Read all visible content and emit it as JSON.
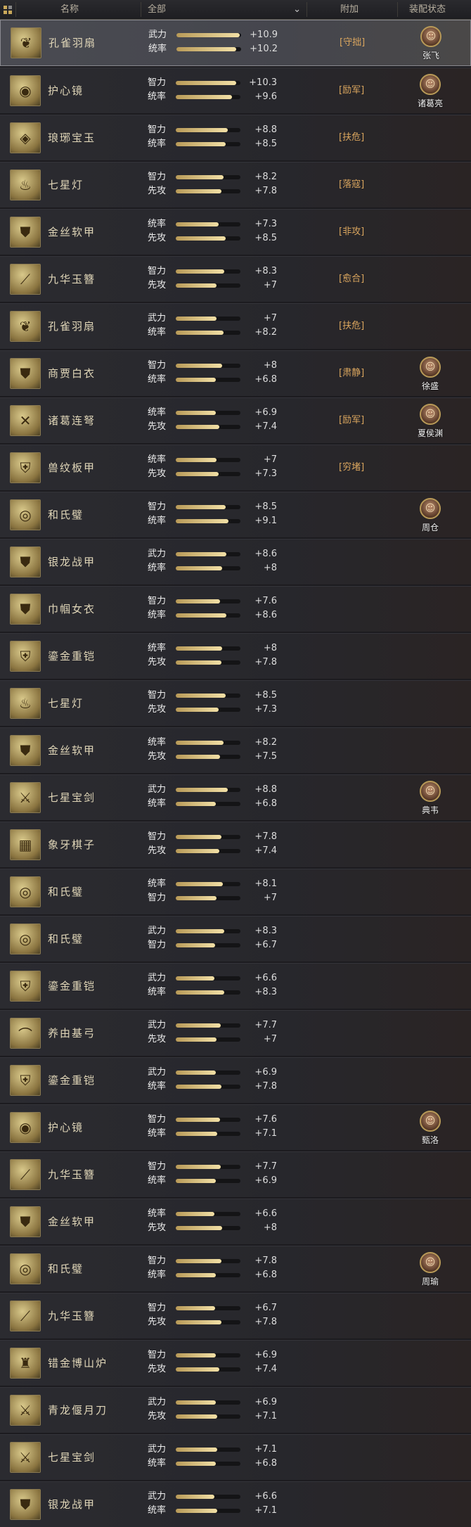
{
  "header": {
    "name_col": "名称",
    "filter_value": "全部",
    "extra_col": "附加",
    "equip_col": "装配状态"
  },
  "items": [
    {
      "name": "孔雀羽扇",
      "s1": "武力",
      "v1": "+10.9",
      "p1": 0.98,
      "s2": "统率",
      "v2": "+10.2",
      "p2": 0.92,
      "tag": "[守拙]",
      "general": "张飞",
      "icon": "fan"
    },
    {
      "name": "护心镜",
      "s1": "智力",
      "v1": "+10.3",
      "p1": 0.93,
      "s2": "统率",
      "v2": "+9.6",
      "p2": 0.87,
      "tag": "[励军]",
      "general": "诸葛亮",
      "icon": "mirror"
    },
    {
      "name": "琅琊宝玉",
      "s1": "智力",
      "v1": "+8.8",
      "p1": 0.8,
      "s2": "统率",
      "v2": "+8.5",
      "p2": 0.77,
      "tag": "[扶危]",
      "general": "",
      "icon": "jade"
    },
    {
      "name": "七星灯",
      "s1": "智力",
      "v1": "+8.2",
      "p1": 0.74,
      "s2": "先攻",
      "v2": "+7.8",
      "p2": 0.71,
      "tag": "[落寇]",
      "general": "",
      "icon": "lamp"
    },
    {
      "name": "金丝软甲",
      "s1": "统率",
      "v1": "+7.3",
      "p1": 0.66,
      "s2": "先攻",
      "v2": "+8.5",
      "p2": 0.77,
      "tag": "[非攻]",
      "general": "",
      "icon": "armor"
    },
    {
      "name": "九华玉簪",
      "s1": "智力",
      "v1": "+8.3",
      "p1": 0.75,
      "s2": "先攻",
      "v2": "+7",
      "p2": 0.63,
      "tag": "[愈合]",
      "general": "",
      "icon": "hairpin"
    },
    {
      "name": "孔雀羽扇",
      "s1": "武力",
      "v1": "+7",
      "p1": 0.63,
      "s2": "统率",
      "v2": "+8.2",
      "p2": 0.74,
      "tag": "[扶危]",
      "general": "",
      "icon": "fan"
    },
    {
      "name": "商贾白衣",
      "s1": "智力",
      "v1": "+8",
      "p1": 0.72,
      "s2": "统率",
      "v2": "+6.8",
      "p2": 0.62,
      "tag": "[肃静]",
      "general": "徐盛",
      "icon": "robe"
    },
    {
      "name": "诸葛连弩",
      "s1": "统率",
      "v1": "+6.9",
      "p1": 0.62,
      "s2": "先攻",
      "v2": "+7.4",
      "p2": 0.67,
      "tag": "[励军]",
      "general": "夏侯渊",
      "icon": "crossbow"
    },
    {
      "name": "兽纹板甲",
      "s1": "统率",
      "v1": "+7",
      "p1": 0.63,
      "s2": "先攻",
      "v2": "+7.3",
      "p2": 0.66,
      "tag": "[穷堵]",
      "general": "",
      "icon": "plate"
    },
    {
      "name": "和氏璧",
      "s1": "智力",
      "v1": "+8.5",
      "p1": 0.77,
      "s2": "统率",
      "v2": "+9.1",
      "p2": 0.82,
      "tag": "",
      "general": "周仓",
      "icon": "bi"
    },
    {
      "name": "银龙战甲",
      "s1": "武力",
      "v1": "+8.6",
      "p1": 0.78,
      "s2": "统率",
      "v2": "+8",
      "p2": 0.72,
      "tag": "",
      "general": "",
      "icon": "armor"
    },
    {
      "name": "巾帼女衣",
      "s1": "智力",
      "v1": "+7.6",
      "p1": 0.69,
      "s2": "统率",
      "v2": "+8.6",
      "p2": 0.78,
      "tag": "",
      "general": "",
      "icon": "robe"
    },
    {
      "name": "鎏金重铠",
      "s1": "统率",
      "v1": "+8",
      "p1": 0.72,
      "s2": "先攻",
      "v2": "+7.8",
      "p2": 0.71,
      "tag": "",
      "general": "",
      "icon": "plate"
    },
    {
      "name": "七星灯",
      "s1": "智力",
      "v1": "+8.5",
      "p1": 0.77,
      "s2": "先攻",
      "v2": "+7.3",
      "p2": 0.66,
      "tag": "",
      "general": "",
      "icon": "lamp"
    },
    {
      "name": "金丝软甲",
      "s1": "统率",
      "v1": "+8.2",
      "p1": 0.74,
      "s2": "先攻",
      "v2": "+7.5",
      "p2": 0.68,
      "tag": "",
      "general": "",
      "icon": "armor"
    },
    {
      "name": "七星宝剑",
      "s1": "武力",
      "v1": "+8.8",
      "p1": 0.8,
      "s2": "统率",
      "v2": "+6.8",
      "p2": 0.62,
      "tag": "",
      "general": "典韦",
      "icon": "sword"
    },
    {
      "name": "象牙棋子",
      "s1": "智力",
      "v1": "+7.8",
      "p1": 0.71,
      "s2": "先攻",
      "v2": "+7.4",
      "p2": 0.67,
      "tag": "",
      "general": "",
      "icon": "chess"
    },
    {
      "name": "和氏璧",
      "s1": "统率",
      "v1": "+8.1",
      "p1": 0.73,
      "s2": "智力",
      "v2": "+7",
      "p2": 0.63,
      "tag": "",
      "general": "",
      "icon": "bi"
    },
    {
      "name": "和氏璧",
      "s1": "武力",
      "v1": "+8.3",
      "p1": 0.75,
      "s2": "智力",
      "v2": "+6.7",
      "p2": 0.61,
      "tag": "",
      "general": "",
      "icon": "bi"
    },
    {
      "name": "鎏金重铠",
      "s1": "武力",
      "v1": "+6.6",
      "p1": 0.6,
      "s2": "统率",
      "v2": "+8.3",
      "p2": 0.75,
      "tag": "",
      "general": "",
      "icon": "plate"
    },
    {
      "name": "养由基弓",
      "s1": "武力",
      "v1": "+7.7",
      "p1": 0.7,
      "s2": "先攻",
      "v2": "+7",
      "p2": 0.63,
      "tag": "",
      "general": "",
      "icon": "bow"
    },
    {
      "name": "鎏金重铠",
      "s1": "武力",
      "v1": "+6.9",
      "p1": 0.62,
      "s2": "统率",
      "v2": "+7.8",
      "p2": 0.71,
      "tag": "",
      "general": "",
      "icon": "plate"
    },
    {
      "name": "护心镜",
      "s1": "智力",
      "v1": "+7.6",
      "p1": 0.69,
      "s2": "统率",
      "v2": "+7.1",
      "p2": 0.64,
      "tag": "",
      "general": "甄洛",
      "icon": "mirror"
    },
    {
      "name": "九华玉簪",
      "s1": "智力",
      "v1": "+7.7",
      "p1": 0.7,
      "s2": "统率",
      "v2": "+6.9",
      "p2": 0.62,
      "tag": "",
      "general": "",
      "icon": "hairpin"
    },
    {
      "name": "金丝软甲",
      "s1": "统率",
      "v1": "+6.6",
      "p1": 0.6,
      "s2": "先攻",
      "v2": "+8",
      "p2": 0.72,
      "tag": "",
      "general": "",
      "icon": "armor"
    },
    {
      "name": "和氏璧",
      "s1": "智力",
      "v1": "+7.8",
      "p1": 0.71,
      "s2": "统率",
      "v2": "+6.8",
      "p2": 0.62,
      "tag": "",
      "general": "周瑜",
      "icon": "bi"
    },
    {
      "name": "九华玉簪",
      "s1": "智力",
      "v1": "+6.7",
      "p1": 0.61,
      "s2": "先攻",
      "v2": "+7.8",
      "p2": 0.71,
      "tag": "",
      "general": "",
      "icon": "hairpin"
    },
    {
      "name": "错金博山炉",
      "s1": "智力",
      "v1": "+6.9",
      "p1": 0.62,
      "s2": "先攻",
      "v2": "+7.4",
      "p2": 0.67,
      "tag": "",
      "general": "",
      "icon": "censer"
    },
    {
      "name": "青龙偃月刀",
      "s1": "武力",
      "v1": "+6.9",
      "p1": 0.62,
      "s2": "先攻",
      "v2": "+7.1",
      "p2": 0.64,
      "tag": "",
      "general": "",
      "icon": "blade"
    },
    {
      "name": "七星宝剑",
      "s1": "武力",
      "v1": "+7.1",
      "p1": 0.64,
      "s2": "统率",
      "v2": "+6.8",
      "p2": 0.62,
      "tag": "",
      "general": "",
      "icon": "sword"
    },
    {
      "name": "银龙战甲",
      "s1": "武力",
      "v1": "+6.6",
      "p1": 0.6,
      "s2": "统率",
      "v2": "+7.1",
      "p2": 0.64,
      "tag": "",
      "general": "",
      "icon": "armor"
    }
  ],
  "colors": {
    "accent": "#c9a85a",
    "tag": "#d9a55e",
    "selected_bg": "#4a4b52"
  }
}
